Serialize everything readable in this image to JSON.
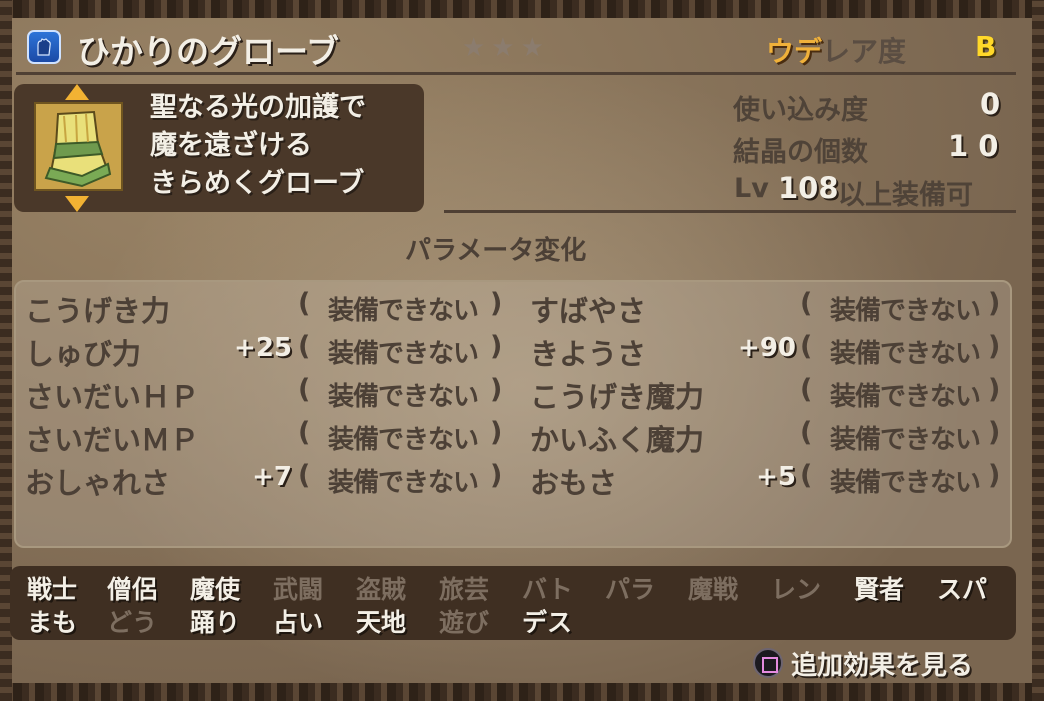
{
  "item": {
    "name": "ひかりのグローブ",
    "stars": "★★★",
    "rarity_prefix": "ウデ",
    "rarity_label": "レア度",
    "rarity_grade": "B",
    "description": [
      "聖なる光の加護で",
      "魔を遠ざける",
      "きらめくグローブ"
    ],
    "icon": "glove-icon"
  },
  "stats": {
    "usage_label": "使い込み度",
    "usage_value": "0",
    "crystal_label": "結晶の個数",
    "crystal_value": "1 0",
    "level_prefix": "Lv",
    "level_value": "108",
    "level_suffix": "以上装備可"
  },
  "params": {
    "title": "パラメータ変化",
    "cannot_equip": "装備できない",
    "open": "(",
    "close": ")",
    "left": [
      {
        "name": "こうげき力",
        "bonus": ""
      },
      {
        "name": "しゅび力",
        "bonus": "+25"
      },
      {
        "name": "さいだいＨＰ",
        "bonus": ""
      },
      {
        "name": "さいだいＭＰ",
        "bonus": ""
      },
      {
        "name": "おしゃれさ",
        "bonus": "+7"
      }
    ],
    "right": [
      {
        "name": "すばやさ",
        "bonus": ""
      },
      {
        "name": "きようさ",
        "bonus": "+90"
      },
      {
        "name": "こうげき魔力",
        "bonus": ""
      },
      {
        "name": "かいふく魔力",
        "bonus": ""
      },
      {
        "name": "おもさ",
        "bonus": "+5"
      }
    ]
  },
  "jobs": {
    "row1": [
      {
        "name": "戦士",
        "on": true
      },
      {
        "name": "僧侶",
        "on": true
      },
      {
        "name": "魔使",
        "on": true
      },
      {
        "name": "武闘",
        "on": false
      },
      {
        "name": "盗賊",
        "on": false
      },
      {
        "name": "旅芸",
        "on": false
      },
      {
        "name": "バト",
        "on": false
      },
      {
        "name": "パラ",
        "on": false
      },
      {
        "name": "魔戦",
        "on": false
      },
      {
        "name": "レン",
        "on": false
      },
      {
        "name": "賢者",
        "on": true
      },
      {
        "name": "スパ",
        "on": true
      }
    ],
    "row2": [
      {
        "name": "まも",
        "on": true
      },
      {
        "name": "どう",
        "on": false
      },
      {
        "name": "踊り",
        "on": true
      },
      {
        "name": "占い",
        "on": true
      },
      {
        "name": "天地",
        "on": true
      },
      {
        "name": "遊び",
        "on": false
      },
      {
        "name": "デス",
        "on": true
      }
    ]
  },
  "footer": {
    "button_icon": "square-button-icon",
    "more_effects": "追加効果を見る"
  },
  "colors": {
    "bonus": "#f3efe6",
    "accent_gold": "#ffd829",
    "arrow": "#f2b233"
  }
}
